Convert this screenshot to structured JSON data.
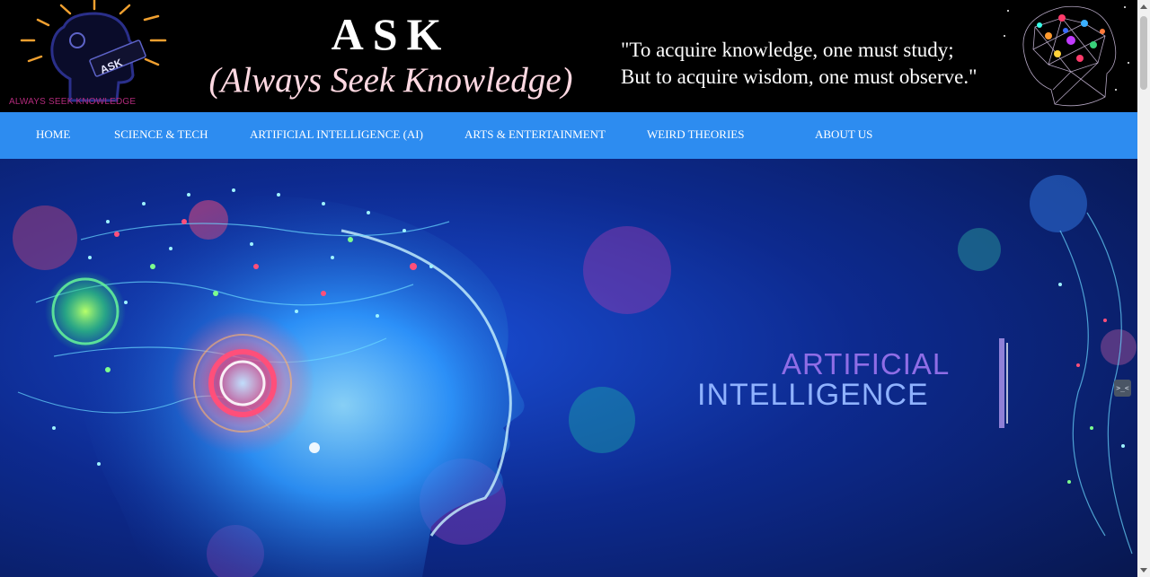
{
  "header": {
    "title": "ASK",
    "subtitle": "(Always Seek Knowledge)",
    "logo_text": "ALWAYS SEEK KNOWLEDGE",
    "logo_badge": "ASK",
    "quote_line1": "\"To acquire knowledge, one must study;",
    "quote_line2": "But to acquire wisdom, one must observe.\""
  },
  "nav": {
    "items": [
      {
        "label": "HOME"
      },
      {
        "label": "SCIENCE & TECH"
      },
      {
        "label": "ARTIFICIAL INTELLIGENCE (AI)"
      },
      {
        "label": "ARTS & ENTERTAINMENT"
      },
      {
        "label": "WEIRD THEORIES"
      },
      {
        "label": "ABOUT US"
      }
    ]
  },
  "hero": {
    "line1": "ARTIFICIAL",
    "line2": "INTELLIGENCE"
  },
  "side_badge": ">_<",
  "colors": {
    "header_bg": "#000000",
    "nav_bg": "#2d8cf0",
    "subtitle": "#ffd9e2",
    "hero_bg": "#0a1f6e"
  },
  "icons": [
    "lightbulb-head-logo-icon",
    "brain-network-icon",
    "ai-face-illustration"
  ]
}
